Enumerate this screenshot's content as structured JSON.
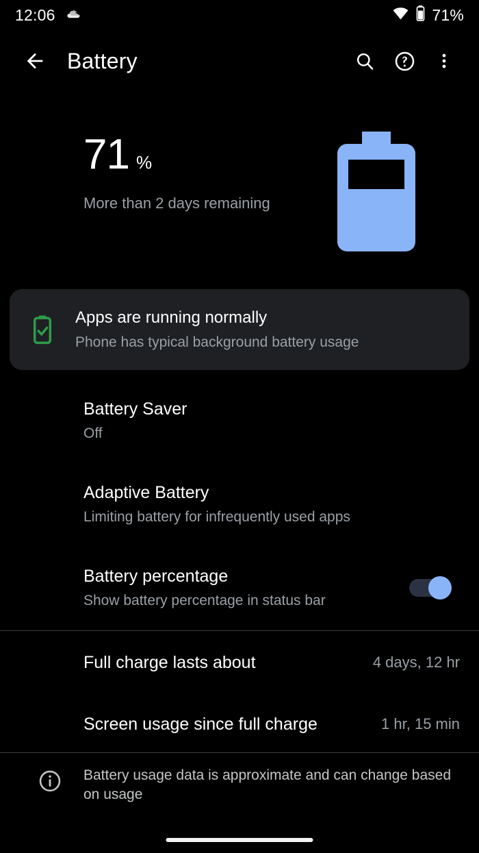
{
  "status_bar": {
    "time": "12:06",
    "cloud_icon": "cloud-icon",
    "wifi_icon": "wifi-icon",
    "battery_icon": "battery-icon",
    "battery_percent": "71%"
  },
  "app_bar": {
    "back_icon": "back-arrow-icon",
    "title": "Battery",
    "search_icon": "search-icon",
    "help_icon": "help-circle-icon",
    "overflow_icon": "more-vert-icon"
  },
  "hero": {
    "percent": "71",
    "percent_sign": "%",
    "estimate": "More than 2 days remaining",
    "battery_graphic": "battery-large-icon",
    "battery_color": "#8ab4f8",
    "battery_level_pct": 71
  },
  "tip_card": {
    "icon": "battery-check-icon",
    "icon_color": "#2e9b4a",
    "background": "#1e2023",
    "title": "Apps are running normally",
    "subtitle": "Phone has typical background battery usage"
  },
  "preferences": [
    {
      "name": "battery-saver",
      "title": "Battery Saver",
      "subtitle": "Off",
      "has_switch": false
    },
    {
      "name": "adaptive-battery",
      "title": "Adaptive Battery",
      "subtitle": "Limiting battery for infrequently used apps",
      "has_switch": false
    },
    {
      "name": "battery-percentage",
      "title": "Battery percentage",
      "subtitle": "Show battery percentage in status bar",
      "has_switch": true,
      "switch_on": true,
      "switch_thumb_color": "#8ab4f8",
      "switch_track_color": "#2b3244"
    }
  ],
  "stats": [
    {
      "name": "full-charge-lasts-about",
      "label": "Full charge lasts about",
      "value": "4 days, 12 hr"
    },
    {
      "name": "screen-usage-since-full-charge",
      "label": "Screen usage since full charge",
      "value": "1 hr, 15 min"
    }
  ],
  "footnote": {
    "icon": "info-circle-icon",
    "text": "Battery usage data is approximate and can change based on usage"
  },
  "nav": {
    "pill": "gesture-nav-pill"
  }
}
